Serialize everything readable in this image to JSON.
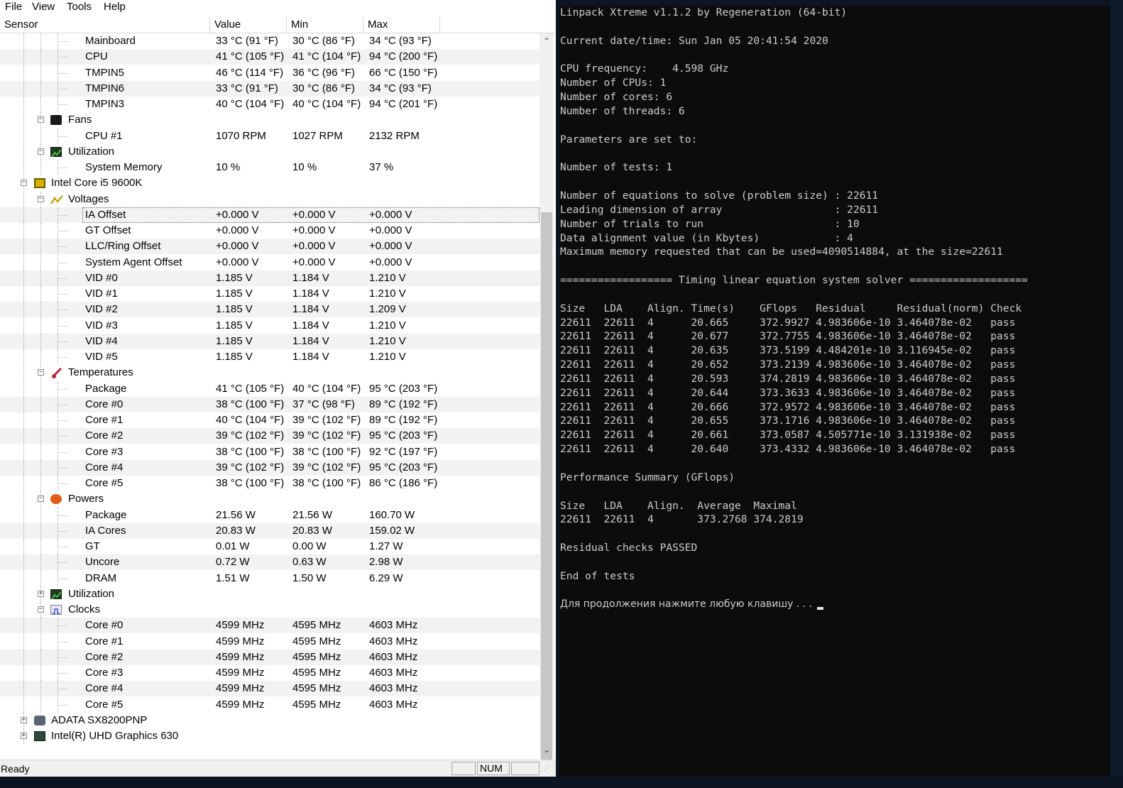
{
  "hwmonitor": {
    "menu": [
      "File",
      "View",
      "Tools",
      "Help"
    ],
    "columns": [
      "Sensor",
      "Value",
      "Min",
      "Max"
    ],
    "rows": [
      {
        "level": 3,
        "name": "Mainboard",
        "value": "33 °C  (91 °F)",
        "min": "30 °C  (86 °F)",
        "max": "34 °C  (93 °F)"
      },
      {
        "level": 3,
        "name": "CPU",
        "value": "41 °C  (105 °F)",
        "min": "41 °C  (104 °F)",
        "max": "94 °C  (200 °F)"
      },
      {
        "level": 3,
        "name": "TMPIN5",
        "value": "46 °C  (114 °F)",
        "min": "36 °C  (96 °F)",
        "max": "66 °C  (150 °F)"
      },
      {
        "level": 3,
        "name": "TMPIN6",
        "value": "33 °C  (91 °F)",
        "min": "30 °C  (86 °F)",
        "max": "34 °C  (93 °F)"
      },
      {
        "level": 3,
        "name": "TMPIN3",
        "value": "40 °C  (104 °F)",
        "min": "40 °C  (104 °F)",
        "max": "94 °C  (201 °F)"
      },
      {
        "level": 2,
        "name": "Fans",
        "icon": "fan-icon",
        "expander": "−"
      },
      {
        "level": 3,
        "name": "CPU #1",
        "value": "1070 RPM",
        "min": "1027 RPM",
        "max": "2132 RPM"
      },
      {
        "level": 2,
        "name": "Utilization",
        "icon": "utilization-icon",
        "expander": "−"
      },
      {
        "level": 3,
        "name": "System Memory",
        "value": "10 %",
        "min": "10 %",
        "max": "37 %"
      },
      {
        "level": 1,
        "name": "Intel Core i5 9600K",
        "icon": "cpu-chip-icon",
        "expander": "−"
      },
      {
        "level": 2,
        "name": "Voltages",
        "icon": "voltage-icon",
        "expander": "−"
      },
      {
        "level": 3,
        "name": "IA Offset",
        "value": "+0.000 V",
        "min": "+0.000 V",
        "max": "+0.000 V",
        "selected": true
      },
      {
        "level": 3,
        "name": "GT Offset",
        "value": "+0.000 V",
        "min": "+0.000 V",
        "max": "+0.000 V"
      },
      {
        "level": 3,
        "name": "LLC/Ring Offset",
        "value": "+0.000 V",
        "min": "+0.000 V",
        "max": "+0.000 V"
      },
      {
        "level": 3,
        "name": "System Agent Offset",
        "value": "+0.000 V",
        "min": "+0.000 V",
        "max": "+0.000 V"
      },
      {
        "level": 3,
        "name": "VID #0",
        "value": "1.185 V",
        "min": "1.184 V",
        "max": "1.210 V"
      },
      {
        "level": 3,
        "name": "VID #1",
        "value": "1.185 V",
        "min": "1.184 V",
        "max": "1.210 V"
      },
      {
        "level": 3,
        "name": "VID #2",
        "value": "1.185 V",
        "min": "1.184 V",
        "max": "1.209 V"
      },
      {
        "level": 3,
        "name": "VID #3",
        "value": "1.185 V",
        "min": "1.184 V",
        "max": "1.210 V"
      },
      {
        "level": 3,
        "name": "VID #4",
        "value": "1.185 V",
        "min": "1.184 V",
        "max": "1.210 V"
      },
      {
        "level": 3,
        "name": "VID #5",
        "value": "1.185 V",
        "min": "1.184 V",
        "max": "1.210 V"
      },
      {
        "level": 2,
        "name": "Temperatures",
        "icon": "thermometer-icon",
        "expander": "−"
      },
      {
        "level": 3,
        "name": "Package",
        "value": "41 °C  (105 °F)",
        "min": "40 °C  (104 °F)",
        "max": "95 °C  (203 °F)"
      },
      {
        "level": 3,
        "name": "Core #0",
        "value": "38 °C  (100 °F)",
        "min": "37 °C  (98 °F)",
        "max": "89 °C  (192 °F)"
      },
      {
        "level": 3,
        "name": "Core #1",
        "value": "40 °C  (104 °F)",
        "min": "39 °C  (102 °F)",
        "max": "89 °C  (192 °F)"
      },
      {
        "level": 3,
        "name": "Core #2",
        "value": "39 °C  (102 °F)",
        "min": "39 °C  (102 °F)",
        "max": "95 °C  (203 °F)"
      },
      {
        "level": 3,
        "name": "Core #3",
        "value": "38 °C  (100 °F)",
        "min": "38 °C  (100 °F)",
        "max": "92 °C  (197 °F)"
      },
      {
        "level": 3,
        "name": "Core #4",
        "value": "39 °C  (102 °F)",
        "min": "39 °C  (102 °F)",
        "max": "95 °C  (203 °F)"
      },
      {
        "level": 3,
        "name": "Core #5",
        "value": "38 °C  (100 °F)",
        "min": "38 °C  (100 °F)",
        "max": "86 °C  (186 °F)"
      },
      {
        "level": 2,
        "name": "Powers",
        "icon": "power-icon",
        "expander": "−"
      },
      {
        "level": 3,
        "name": "Package",
        "value": "21.56 W",
        "min": "21.56 W",
        "max": "160.70 W"
      },
      {
        "level": 3,
        "name": "IA Cores",
        "value": "20.83 W",
        "min": "20.83 W",
        "max": "159.02 W"
      },
      {
        "level": 3,
        "name": "GT",
        "value": "0.01 W",
        "min": "0.00 W",
        "max": "1.27 W"
      },
      {
        "level": 3,
        "name": "Uncore",
        "value": "0.72 W",
        "min": "0.63 W",
        "max": "2.98 W"
      },
      {
        "level": 3,
        "name": "DRAM",
        "value": "1.51 W",
        "min": "1.50 W",
        "max": "6.29 W"
      },
      {
        "level": 2,
        "name": "Utilization",
        "icon": "utilization-icon",
        "expander": "+"
      },
      {
        "level": 2,
        "name": "Clocks",
        "icon": "clock-icon",
        "expander": "−"
      },
      {
        "level": 3,
        "name": "Core #0",
        "value": "4599 MHz",
        "min": "4595 MHz",
        "max": "4603 MHz"
      },
      {
        "level": 3,
        "name": "Core #1",
        "value": "4599 MHz",
        "min": "4595 MHz",
        "max": "4603 MHz"
      },
      {
        "level": 3,
        "name": "Core #2",
        "value": "4599 MHz",
        "min": "4595 MHz",
        "max": "4603 MHz"
      },
      {
        "level": 3,
        "name": "Core #3",
        "value": "4599 MHz",
        "min": "4595 MHz",
        "max": "4603 MHz"
      },
      {
        "level": 3,
        "name": "Core #4",
        "value": "4599 MHz",
        "min": "4595 MHz",
        "max": "4603 MHz"
      },
      {
        "level": 3,
        "name": "Core #5",
        "value": "4599 MHz",
        "min": "4595 MHz",
        "max": "4603 MHz"
      },
      {
        "level": 1,
        "name": "ADATA SX8200PNP",
        "icon": "drive-icon",
        "expander": "+"
      },
      {
        "level": 1,
        "name": "Intel(R) UHD Graphics 630",
        "icon": "gpu-icon",
        "expander": "+"
      }
    ],
    "status": {
      "text": "Ready",
      "num": "NUM"
    }
  },
  "console": {
    "lines": [
      "Linpack Xtreme v1.1.2 by Regeneration (64-bit)",
      "",
      "Current date/time: Sun Jan 05 20:41:54 2020",
      "",
      "CPU frequency:    4.598 GHz",
      "Number of CPUs: 1",
      "Number of cores: 6",
      "Number of threads: 6",
      "",
      "Parameters are set to:",
      "",
      "Number of tests: 1",
      "",
      "Number of equations to solve (problem size) : 22611",
      "Leading dimension of array                  : 22611",
      "Number of trials to run                     : 10",
      "Data alignment value (in Kbytes)            : 4",
      "Maximum memory requested that can be used=4090514884, at the size=22611",
      "",
      "================== Timing linear equation system solver ===================",
      "",
      "Size   LDA    Align. Time(s)    GFlops   Residual     Residual(norm) Check",
      "22611  22611  4      20.665     372.9927 4.983606e-10 3.464078e-02   pass",
      "22611  22611  4      20.677     372.7755 4.983606e-10 3.464078e-02   pass",
      "22611  22611  4      20.635     373.5199 4.484201e-10 3.116945e-02   pass",
      "22611  22611  4      20.652     373.2139 4.983606e-10 3.464078e-02   pass",
      "22611  22611  4      20.593     374.2819 4.983606e-10 3.464078e-02   pass",
      "22611  22611  4      20.644     373.3633 4.983606e-10 3.464078e-02   pass",
      "22611  22611  4      20.666     372.9572 4.983606e-10 3.464078e-02   pass",
      "22611  22611  4      20.655     373.1716 4.983606e-10 3.464078e-02   pass",
      "22611  22611  4      20.661     373.0587 4.505771e-10 3.131938e-02   pass",
      "22611  22611  4      20.640     373.4332 4.983606e-10 3.464078e-02   pass",
      "",
      "Performance Summary (GFlops)",
      "",
      "Size   LDA    Align.  Average  Maximal",
      "22611  22611  4       373.2768 374.2819",
      "",
      "Residual checks PASSED",
      "",
      "End of tests",
      ""
    ],
    "prompt": "Для продолжения нажмите любую клавишу . . . "
  }
}
